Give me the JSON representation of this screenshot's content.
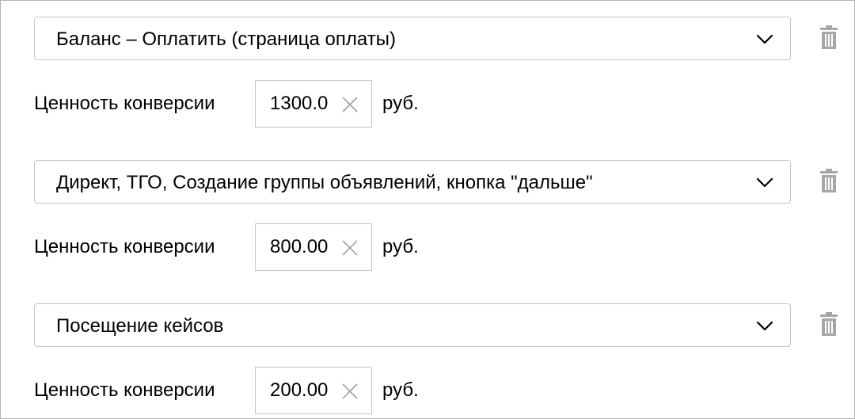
{
  "goals": [
    {
      "select_value": "Баланс – Оплатить (страница оплаты)",
      "value_label": "Ценность конверсии",
      "value": "1300.0",
      "unit": "руб."
    },
    {
      "select_value": "Директ, ТГО, Создание группы объявлений, кнопка \"дальше\"",
      "value_label": "Ценность конверсии",
      "value": "800.00",
      "unit": "руб."
    },
    {
      "select_value": "Посещение кейсов",
      "value_label": "Ценность конверсии",
      "value": "200.00",
      "unit": "руб."
    }
  ],
  "icons": {
    "dropdown": "chevron-down-icon",
    "delete": "trash-icon",
    "clear": "close-icon"
  },
  "colors": {
    "border": "#c6c6c6",
    "icon_muted": "#a6a6a6",
    "text": "#000000"
  }
}
